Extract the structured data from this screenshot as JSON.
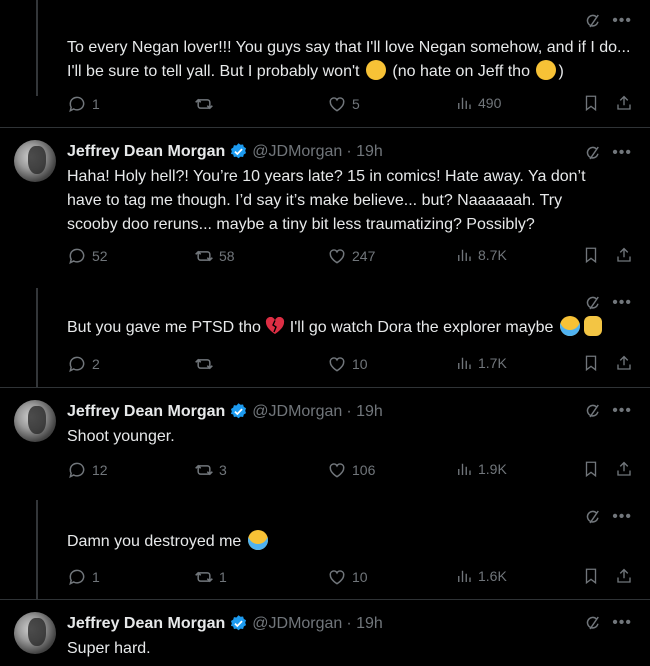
{
  "tweets": [
    {
      "type": "reply",
      "text_parts": [
        "To every Negan lover!!! You guys say that I'll love Negan somehow, and if I do... I'll be sure to tell yall. But I probably won't",
        "(no hate on Jeff tho",
        ")"
      ],
      "replies": "1",
      "retweets": "",
      "likes": "5",
      "views": "490"
    },
    {
      "type": "author",
      "name": "Jeffrey Dean Morgan",
      "handle": "@JDMorgan",
      "time": "· 19h",
      "text": "Haha! Holy hell?! You’re 10 years late? 15 in comics! Hate away. Ya don’t have to tag me though. I’d say it’s make believe... but? Naaaaaah. Try scooby doo reruns... maybe a tiny bit less traumatizing? Possibly?",
      "replies": "52",
      "retweets": "58",
      "likes": "247",
      "views": "8.7K"
    },
    {
      "type": "reply",
      "text_parts": [
        "But you gave me PTSD tho",
        "I'll go watch Dora the explorer maybe"
      ],
      "replies": "2",
      "retweets": "",
      "likes": "10",
      "views": "1.7K"
    },
    {
      "type": "author",
      "name": "Jeffrey Dean Morgan",
      "handle": "@JDMorgan",
      "time": "· 19h",
      "text": "Shoot younger.",
      "replies": "12",
      "retweets": "3",
      "likes": "106",
      "views": "1.9K"
    },
    {
      "type": "reply",
      "text": "Damn you destroyed me",
      "replies": "1",
      "retweets": "1",
      "likes": "10",
      "views": "1.6K"
    },
    {
      "type": "author",
      "name": "Jeffrey Dean Morgan",
      "handle": "@JDMorgan",
      "time": "· 19h",
      "text": "Super hard."
    }
  ],
  "colors": {
    "background": "#000000",
    "text": "#e7e9ea",
    "muted": "#71767b",
    "verified": "#1d9bf0",
    "divider": "#2f3336"
  },
  "icons": [
    "grok-icon",
    "more-icon",
    "reply-icon",
    "retweet-icon",
    "like-icon",
    "views-icon",
    "bookmark-icon",
    "share-icon",
    "verified-badge-icon"
  ]
}
